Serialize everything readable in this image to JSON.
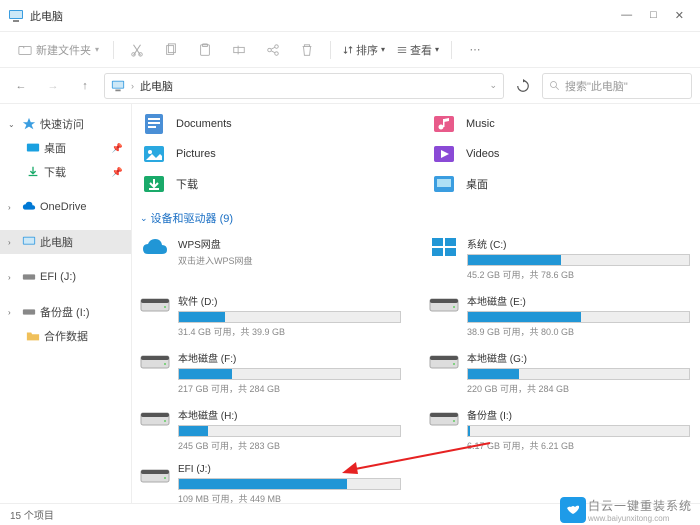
{
  "titlebar": {
    "title": "此电脑"
  },
  "toolbar": {
    "newFolder": "新建文件夹",
    "sort": "排序",
    "view": "查看"
  },
  "address": {
    "location": "此电脑",
    "searchPlaceholder": "搜索\"此电脑\""
  },
  "sidebar": {
    "quickAccess": "快速访问",
    "desktop": "桌面",
    "downloads": "下载",
    "onedrive": "OneDrive",
    "thisPc": "此电脑",
    "efi": "EFI (J:)",
    "backup": "备份盘 (I:)",
    "shared": "合作数据"
  },
  "libraries": [
    {
      "name": "Documents",
      "color": "#4a8fd6"
    },
    {
      "name": "Music",
      "color": "#e85a8a"
    },
    {
      "name": "Pictures",
      "color": "#2aa8e0"
    },
    {
      "name": "Videos",
      "color": "#8a4ad6"
    },
    {
      "name": "下载",
      "color": "#1aaa6a"
    },
    {
      "name": "桌面",
      "color": "#3a9de0"
    }
  ],
  "section": {
    "title": "设备和驱动器 (9)"
  },
  "drives": [
    {
      "name": "WPS网盘",
      "sub": "双击进入WPS网盘",
      "type": "cloud"
    },
    {
      "name": "系统 (C:)",
      "free": "45.2 GB 可用，共 78.6 GB",
      "pct": 42,
      "type": "win"
    },
    {
      "name": "软件 (D:)",
      "free": "31.4 GB 可用，共 39.9 GB",
      "pct": 21,
      "type": "hdd"
    },
    {
      "name": "本地磁盘 (E:)",
      "free": "38.9 GB 可用，共 80.0 GB",
      "pct": 51,
      "type": "hdd"
    },
    {
      "name": "本地磁盘 (F:)",
      "free": "217 GB 可用，共 284 GB",
      "pct": 24,
      "type": "hdd"
    },
    {
      "name": "本地磁盘 (G:)",
      "free": "220 GB 可用，共 284 GB",
      "pct": 23,
      "type": "hdd"
    },
    {
      "name": "本地磁盘 (H:)",
      "free": "245 GB 可用，共 283 GB",
      "pct": 13,
      "type": "hdd"
    },
    {
      "name": "备份盘 (I:)",
      "free": "6.17 GB 可用，共 6.21 GB",
      "pct": 1,
      "type": "hdd"
    },
    {
      "name": "EFI (J:)",
      "free": "109 MB 可用，共 449 MB",
      "pct": 76,
      "type": "hdd"
    }
  ],
  "status": {
    "items": "15 个项目"
  },
  "watermark": {
    "text": "白云一键重装系统",
    "url": "www.baiyunxitong.com"
  }
}
